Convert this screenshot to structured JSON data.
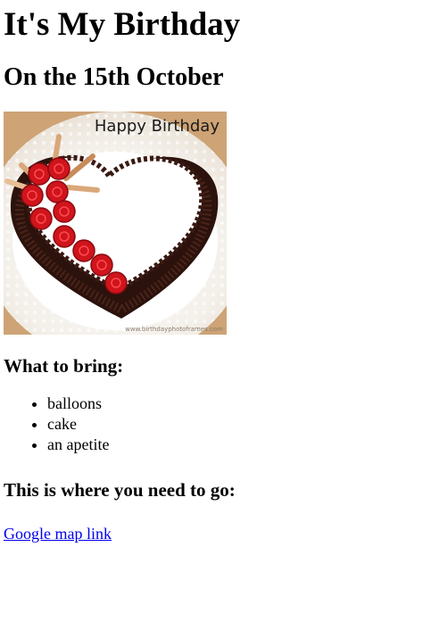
{
  "page": {
    "title": "It's My Birthday",
    "date_heading": "On the 15th October",
    "image": {
      "caption_text": "Happy Birthday",
      "watermark": "www.birthdayphotoframes.com",
      "colors": {
        "chocolate": "#3a1a12",
        "rose": "#d0141c",
        "lace": "#f2ece4",
        "board": "#c79a6b"
      }
    },
    "bring_heading": "What to bring:",
    "bring_items": [
      "balloons",
      "cake",
      "an apetite"
    ],
    "go_heading": "This is where you need to go:",
    "map_link": {
      "label": "Google map link",
      "color": "#0000ee"
    }
  }
}
